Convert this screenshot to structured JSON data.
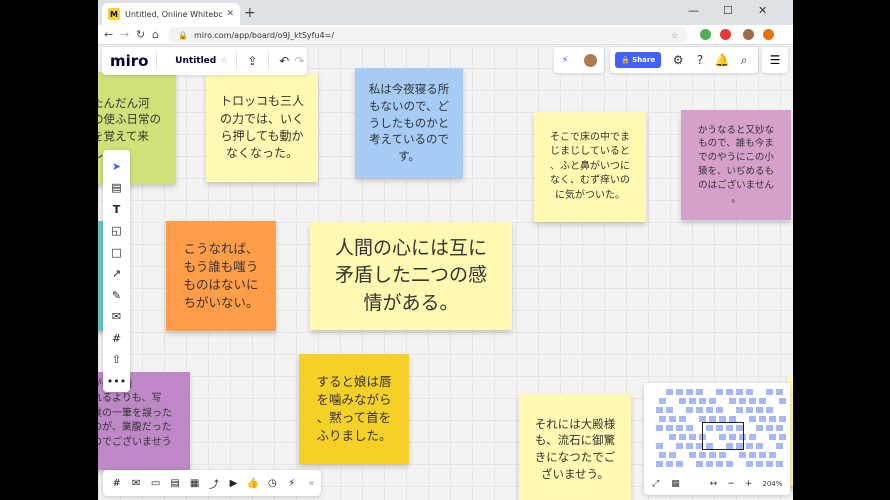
{
  "browser": {
    "tab_title": "Untitled, Online Whiteboard for",
    "tab_favicon": "M",
    "new_tab": "+",
    "url": "miro.com/app/board/o9J_ktSyfu4=/",
    "win_min": "—",
    "win_max": "☐",
    "win_close": "✕"
  },
  "miro": {
    "logo": "miro",
    "board_name": "Untitled",
    "share_label": "Share",
    "zoom": "204%"
  },
  "notes": {
    "n1": "たんだん河\nの使ふ日常の\nを覚えて来\nし。",
    "n2": "トロッコも三人\nの力では、いく\nら押しても動か\nなくなった。",
    "n3": "私は今夜寝る所\nもないので、ど\nうしたものかと\n考えているので\nす。",
    "n4": "そこで床の中でま\nじまじしていると\n、ふと鼻がいつに\nなく、むず痒いの\nに気がついた。",
    "n5": "かうなると又妙な\nもので、誰も今ま\nでのやうにこの小\n猿を、いぢめるも\nのはございません\n。",
    "n6": "こうなれば、\nもう誰も嗤う\nものはないに\nちがいない。",
    "n7": "人間の心には互に\n矛盾した二つの感\n情がある。",
    "n8": "すると娘は唇\nを噛みながら\n、黙って首を\nふりました。",
    "n9": "それには大殿様\nも、流石に御驚\nきになつたでご\nざいませう。",
    "n10": "が蛇に噛\nれるよりも、写\n眞の一筆を誤った\nのが、業腹だった\nのでございませう\n。"
  },
  "colors": {
    "green": "#d0e17a",
    "yellow": "#fff9b1",
    "blue": "#a6ccf5",
    "pink": "#d5a1cb",
    "orange": "#ff9d48",
    "gold": "#f5d128",
    "purple": "#be88c7",
    "teal": "#67c6c0",
    "accent": "#4262ff"
  }
}
